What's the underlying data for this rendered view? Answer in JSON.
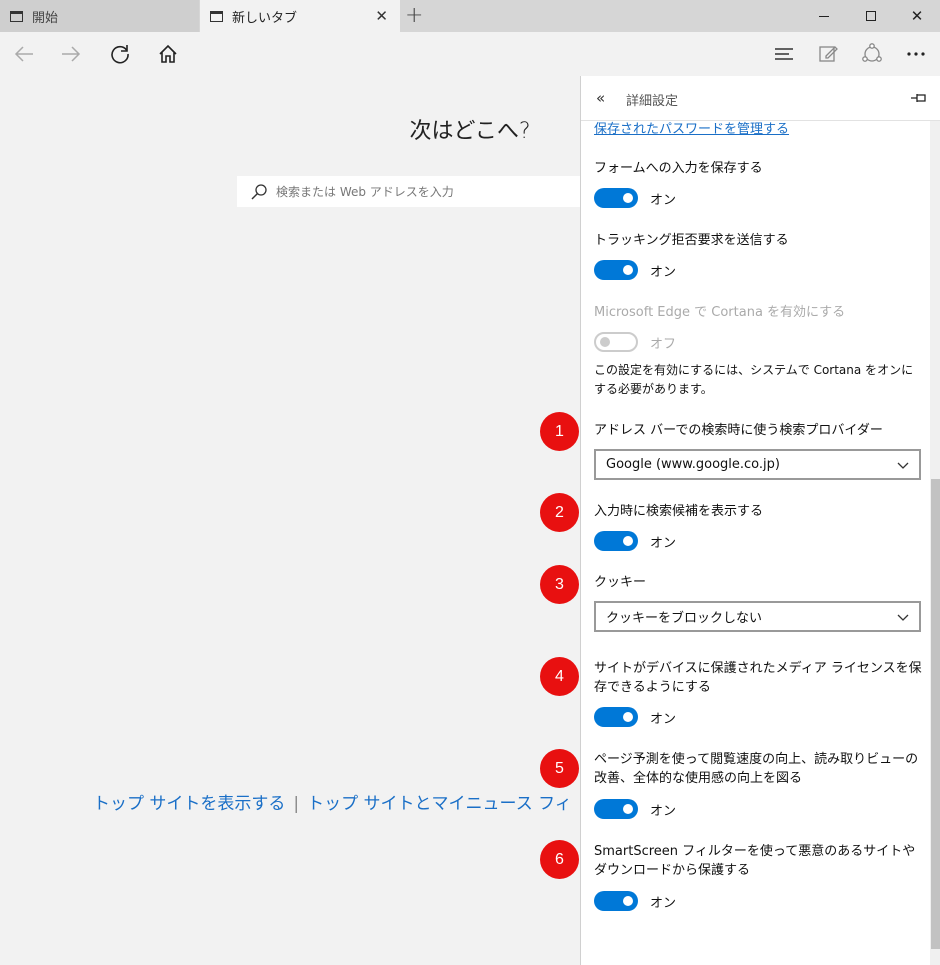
{
  "tabs": [
    {
      "label": "開始"
    },
    {
      "label": "新しいタブ"
    }
  ],
  "main": {
    "title": "次はどこへ?",
    "search_placeholder": "検索または Web アドレスを入力",
    "top_sites_link": "トップ サイトを表示する",
    "top_sites_news_link": "トップ サイトとマイニュース フィ"
  },
  "panel": {
    "title": "詳細設定",
    "password_link": "保存されたパスワードを管理する",
    "form_save": {
      "label": "フォームへの入力を保存する",
      "state": "オン"
    },
    "dnt": {
      "label": "トラッキング拒否要求を送信する",
      "state": "オン"
    },
    "cortana": {
      "label": "Microsoft Edge で Cortana を有効にする",
      "state": "オフ",
      "note": "この設定を有効にするには、システムで Cortana をオンにする必要があります。"
    },
    "search_provider": {
      "label": "アドレス バーでの検索時に使う検索プロバイダー",
      "value": "Google (www.google.co.jp)"
    },
    "suggestions": {
      "label": "入力時に検索候補を表示する",
      "state": "オン"
    },
    "cookies": {
      "label": "クッキー",
      "value": "クッキーをブロックしない"
    },
    "media_license": {
      "label": "サイトがデバイスに保護されたメディア ライセンスを保存できるようにする",
      "state": "オン"
    },
    "page_prediction": {
      "label": "ページ予測を使って閲覧速度の向上、読み取りビューの改善、全体的な使用感の向上を図る",
      "state": "オン"
    },
    "smartscreen": {
      "label": "SmartScreen フィルターを使って悪意のあるサイトやダウンロードから保護する",
      "state": "オン"
    }
  },
  "markers": [
    "1",
    "2",
    "3",
    "4",
    "5",
    "6"
  ]
}
